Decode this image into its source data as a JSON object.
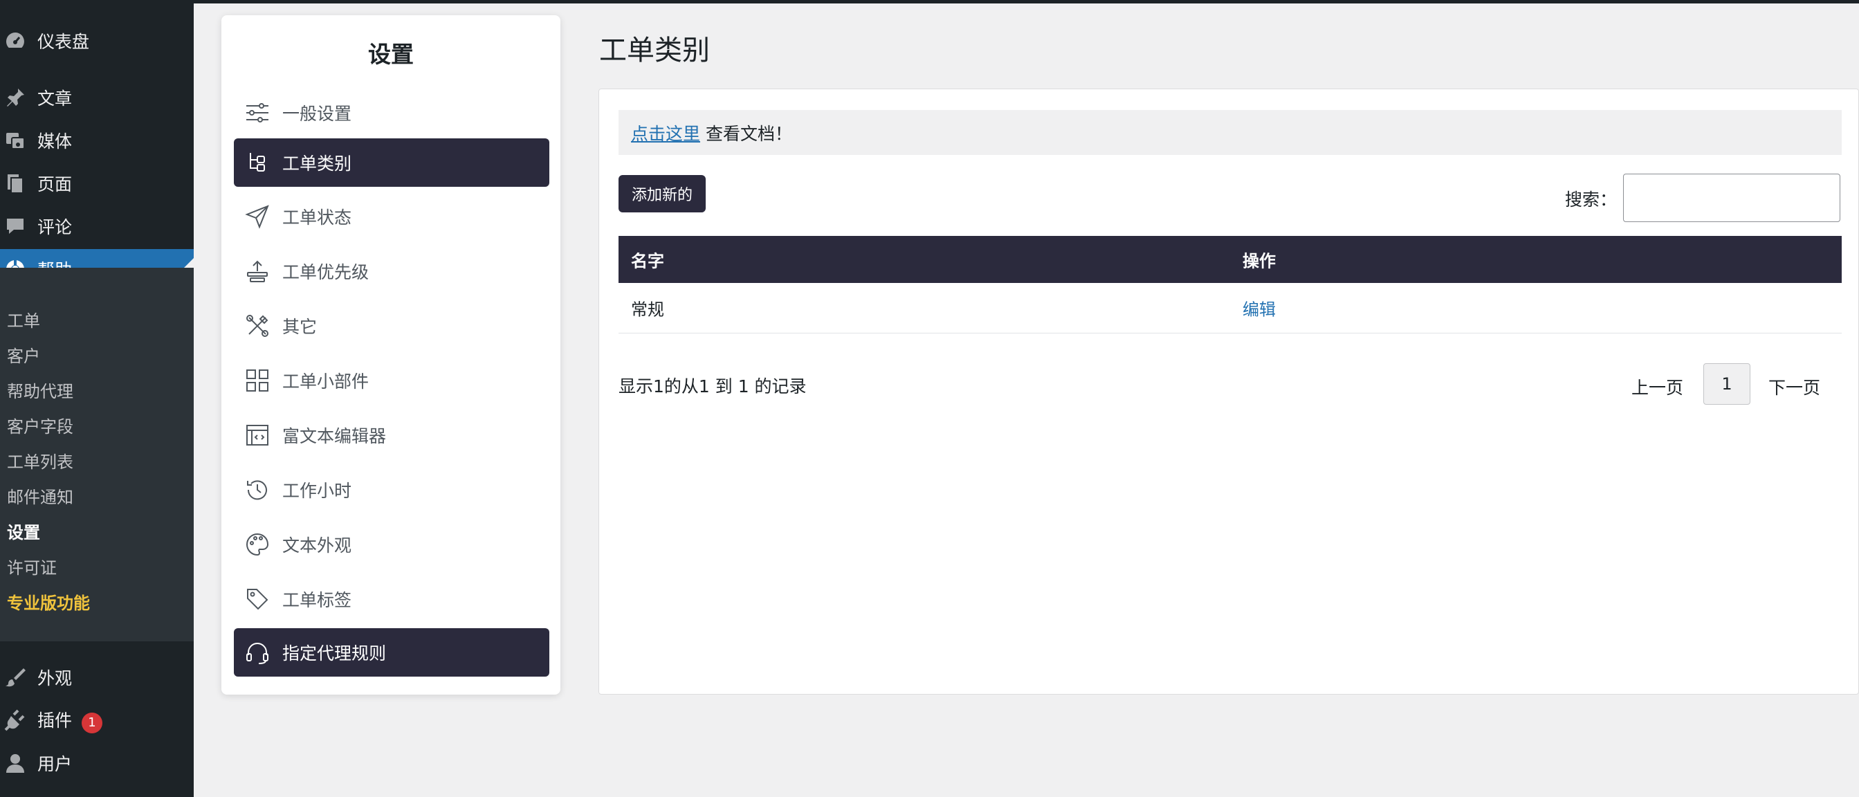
{
  "wp_menu": {
    "top": [
      {
        "label": "仪表盘",
        "icon": "dashboard-icon"
      },
      {
        "label": "文章",
        "icon": "pin-icon"
      },
      {
        "label": "媒体",
        "icon": "media-icon"
      },
      {
        "label": "页面",
        "icon": "pages-icon"
      },
      {
        "label": "评论",
        "icon": "comment-icon"
      },
      {
        "label": "帮助",
        "icon": "lifebuoy-icon"
      }
    ],
    "submenu": [
      "工单",
      "客户",
      "帮助代理",
      "客户字段",
      "工单列表",
      "邮件通知",
      "设置",
      "许可证",
      "专业版功能"
    ],
    "bottom": [
      {
        "label": "外观",
        "icon": "brush-icon"
      },
      {
        "label": "插件",
        "icon": "plugin-icon",
        "badge": "1"
      },
      {
        "label": "用户",
        "icon": "user-icon"
      }
    ]
  },
  "settings": {
    "title": "设置",
    "items": [
      {
        "label": "一般设置",
        "icon": "sliders-icon"
      },
      {
        "label": "工单类别",
        "icon": "tree-icon"
      },
      {
        "label": "工单状态",
        "icon": "send-icon"
      },
      {
        "label": "工单优先级",
        "icon": "priority-icon"
      },
      {
        "label": "其它",
        "icon": "tools-icon"
      },
      {
        "label": "工单小部件",
        "icon": "widgets-icon"
      },
      {
        "label": "富文本编辑器",
        "icon": "code-editor-icon"
      },
      {
        "label": "工作小时",
        "icon": "clock-history-icon"
      },
      {
        "label": "文本外观",
        "icon": "palette-icon"
      },
      {
        "label": "工单标签",
        "icon": "tag-icon"
      },
      {
        "label": "指定代理规则",
        "icon": "headset-icon"
      }
    ]
  },
  "main": {
    "title": "工单类别",
    "notice_link": "点击这里",
    "notice_text": "查看文档！",
    "add_button": "添加新的",
    "search_label": "搜索：",
    "search_value": "",
    "table": {
      "headers": [
        "名字",
        "操作"
      ],
      "rows": [
        {
          "name": "常规",
          "action": "编辑"
        }
      ]
    },
    "records_text": "显示1的从1 到 1 的记录",
    "pagination": {
      "prev": "上一页",
      "current": "1",
      "next": "下一页"
    }
  },
  "colors": {
    "wp_sidebar": "#1d2327",
    "wp_submenu": "#2c3338",
    "wp_active": "#2271b1",
    "accent_dark": "#2b2a3d",
    "pro_yellow": "#f0c33c",
    "badge_red": "#d63638",
    "link_blue": "#2271b1"
  }
}
